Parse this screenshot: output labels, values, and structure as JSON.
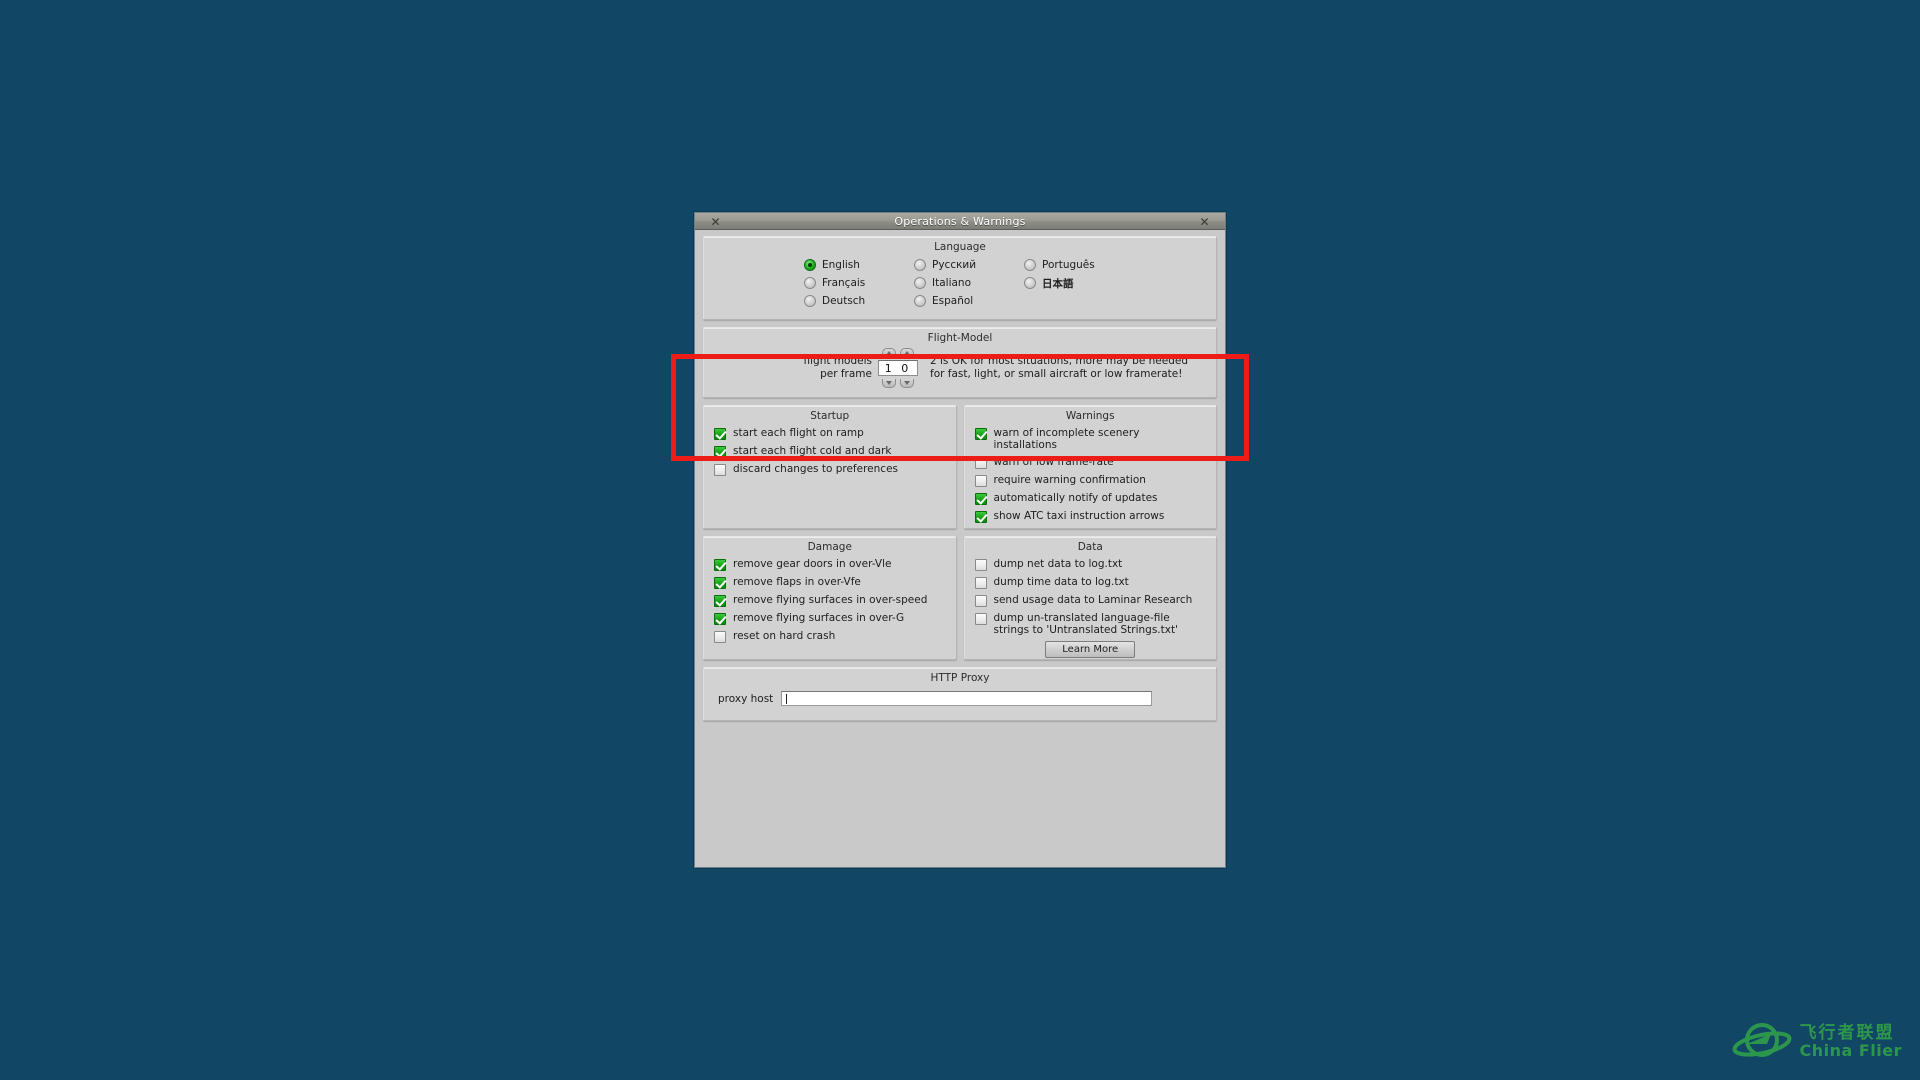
{
  "window": {
    "title": "Operations & Warnings",
    "close_left_icon": "close-icon",
    "close_right_icon": "close-icon"
  },
  "language": {
    "title": "Language",
    "columns": [
      [
        {
          "label": "English",
          "selected": true
        },
        {
          "label": "Français",
          "selected": false
        },
        {
          "label": "Deutsch",
          "selected": false
        }
      ],
      [
        {
          "label": "Русский",
          "selected": false
        },
        {
          "label": "Italiano",
          "selected": false
        },
        {
          "label": "Español",
          "selected": false
        }
      ],
      [
        {
          "label": "Português",
          "selected": false
        },
        {
          "label": "日本語",
          "selected": false,
          "cjk": true
        }
      ]
    ]
  },
  "flight_model": {
    "title": "Flight-Model",
    "label_line1": "flight models",
    "label_line2": "per frame",
    "value": "1 0",
    "note_line1": "2 is OK for most situations, more may be needed",
    "note_line2": "for fast, light, or small aircraft or low framerate!",
    "spinner_up_icon": "chevron-up-icon",
    "spinner_down_icon": "chevron-down-icon"
  },
  "startup": {
    "title": "Startup",
    "items": [
      {
        "label": "start each flight on ramp",
        "checked": true
      },
      {
        "label": "start each flight cold and dark",
        "checked": true
      },
      {
        "label": "discard changes to preferences",
        "checked": false
      }
    ]
  },
  "warnings": {
    "title": "Warnings",
    "items": [
      {
        "label": "warn of incomplete scenery installations",
        "checked": true
      },
      {
        "label": "warn of low frame-rate",
        "checked": false
      },
      {
        "label": "require warning confirmation",
        "checked": false
      },
      {
        "label": "automatically notify of updates",
        "checked": true
      },
      {
        "label": "show ATC taxi instruction arrows",
        "checked": true
      }
    ]
  },
  "damage": {
    "title": "Damage",
    "items": [
      {
        "label": "remove gear doors in over-Vle",
        "checked": true
      },
      {
        "label": "remove flaps in over-Vfe",
        "checked": true
      },
      {
        "label": "remove flying surfaces in over-speed",
        "checked": true
      },
      {
        "label": "remove flying surfaces in over-G",
        "checked": true
      },
      {
        "label": "reset on hard crash",
        "checked": false
      }
    ]
  },
  "data": {
    "title": "Data",
    "items": [
      {
        "label": "dump net data to log.txt",
        "checked": false
      },
      {
        "label": "dump time data to log.txt",
        "checked": false
      },
      {
        "label": "send usage data to Laminar Research",
        "checked": false
      },
      {
        "label": "dump un-translated language-file strings to 'Untranslated Strings.txt'",
        "checked": false
      }
    ],
    "learn_more_label": "Learn More"
  },
  "proxy": {
    "title": "HTTP Proxy",
    "label": "proxy host",
    "value": "",
    "placeholder": ""
  },
  "annotation": {
    "color": "#ee1c18",
    "target": "flight-model-group"
  },
  "watermark": {
    "cn": "飞行者联盟",
    "en": "China Flier",
    "logo_icon": "globe-aircraft-icon",
    "color": "#2f9e4a"
  },
  "desktop": {
    "background_color": "#114664"
  }
}
